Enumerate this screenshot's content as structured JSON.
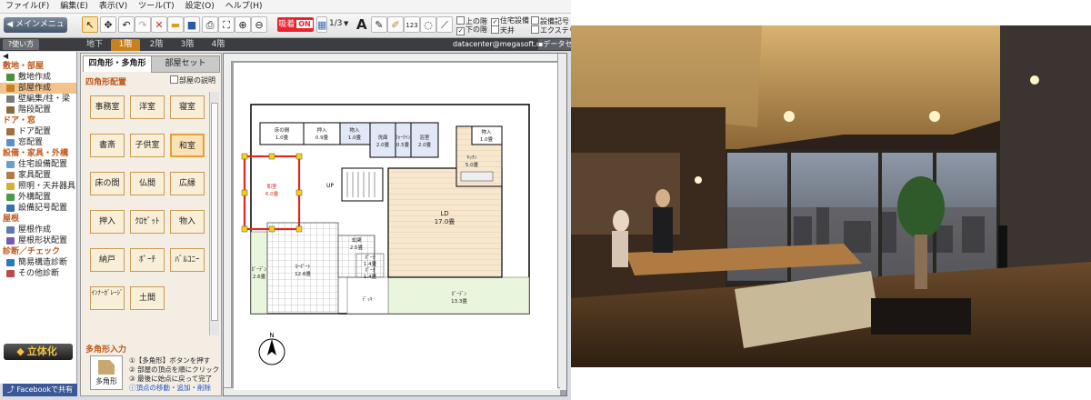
{
  "menu": [
    "ファイル(F)",
    "編集(E)",
    "表示(V)",
    "ツール(T)",
    "設定(O)",
    "ヘルプ(H)"
  ],
  "toolbar": {
    "main_menu": "メインメニュー",
    "grid_label": "吸着",
    "grid_state": "ON",
    "page": "1/3",
    "font_a": "A",
    "dim": "123",
    "checks": [
      {
        "label": "上の階",
        "checked": false
      },
      {
        "label": "下の階",
        "checked": true
      },
      {
        "label": "住宅設備",
        "checked": true
      },
      {
        "label": "天井",
        "checked": false
      },
      {
        "label": "設備記号",
        "checked": false
      },
      {
        "label": "エクステリア",
        "checked": false
      }
    ]
  },
  "floorbar": {
    "usage": "使い方",
    "tabs": [
      "地下",
      "1階",
      "2階",
      "3階",
      "4階"
    ],
    "active": "1階",
    "email": "datacenter@megasoft.co.jp",
    "data_center": "データセン"
  },
  "sidebar": {
    "groups": [
      {
        "title": "敷地・部屋",
        "items": [
          {
            "label": "敷地作成",
            "color": "#4a8f3c"
          },
          {
            "label": "部屋作成",
            "color": "#c9801d",
            "selected": true
          },
          {
            "label": "壁編集/柱・梁",
            "color": "#7a7a7a"
          },
          {
            "label": "階段配置",
            "color": "#8a6a3a"
          }
        ]
      },
      {
        "title": "ドア・窓",
        "items": [
          {
            "label": "ドア配置",
            "color": "#a07040"
          },
          {
            "label": "窓配置",
            "color": "#5b8fc9"
          }
        ]
      },
      {
        "title": "設備・家具・外構",
        "items": [
          {
            "label": "住宅設備配置",
            "color": "#6aa0d0"
          },
          {
            "label": "家具配置",
            "color": "#b07a4a"
          },
          {
            "label": "照明・天井器具",
            "color": "#d8b030"
          },
          {
            "label": "外構配置",
            "color": "#4a9a4a"
          },
          {
            "label": "設備記号配置",
            "color": "#3a70b0"
          }
        ]
      },
      {
        "title": "屋根",
        "items": [
          {
            "label": "屋根作成",
            "color": "#5a7ab0"
          },
          {
            "label": "屋根形状配置",
            "color": "#7a5ab0"
          }
        ]
      },
      {
        "title": "診断／チェック",
        "items": [
          {
            "label": "簡易構造診断",
            "color": "#2a7ac0"
          },
          {
            "label": "その他診断",
            "color": "#c04a4a"
          }
        ]
      }
    ],
    "rittai": "立体化",
    "facebook": "Facebookで共有"
  },
  "panel": {
    "tabs": [
      "四角形・多角形",
      "部屋セット"
    ],
    "section": "四角形配置",
    "explain": "部屋の説明",
    "rooms": [
      "事務室",
      "洋室",
      "寝室",
      "書斎",
      "子供室",
      "和室",
      "床の間",
      "仏間",
      "広縁",
      "押入",
      "ｸﾛｾﾞｯﾄ",
      "物入",
      "納戸",
      "ﾎﾟｰﾁ",
      "ﾊﾞﾙｺﾆｰ",
      "ｲﾝﾅｰｶﾞﾚｰｼﾞ",
      "土間"
    ],
    "selected_room": "和室",
    "poly_section": "多角形入力",
    "poly_button": "多角形",
    "steps": [
      "①【多角形】ボタンを押す",
      "② 部屋の頂点を順にクリック",
      "③ 最後に始点に戻って完了",
      "頂点の移動・追加・削除"
    ]
  },
  "floorplan": {
    "rooms": [
      {
        "name": "床の間",
        "area": "1.0畳"
      },
      {
        "name": "押入",
        "area": "0.9畳"
      },
      {
        "name": "物入",
        "area": "1.0畳"
      },
      {
        "name": "洗面",
        "area": "2.0畳"
      },
      {
        "name": "ｳｫｰｸｲﾝ",
        "area": "0.5畳"
      },
      {
        "name": "浴室",
        "area": "2.0畳"
      },
      {
        "name": "物入",
        "area": "1.0畳"
      },
      {
        "name": "ｷｯﾁﾝ",
        "area": "5.0畳"
      },
      {
        "name": "和室",
        "area": "6.0畳"
      },
      {
        "name": "LD",
        "area": "17.0畳"
      },
      {
        "name": "玄関",
        "area": "2.5畳"
      },
      {
        "name": "ｶﾞｰﾃﾞﾝ",
        "area": "2.6畳"
      },
      {
        "name": "ｶｰﾎﾟｰﾄ",
        "area": "12.6畳"
      },
      {
        "name": "ﾎﾟｰﾁ",
        "area": "1.4畳"
      },
      {
        "name": "ﾎﾟｰﾁ",
        "area": "1.4畳"
      },
      {
        "name": "ｶﾞｰﾃﾞﾝ",
        "area": "13.3畳"
      },
      {
        "name": "ﾃﾞｯｷ",
        "area": ""
      }
    ],
    "up_label": "UP",
    "north": "N"
  }
}
